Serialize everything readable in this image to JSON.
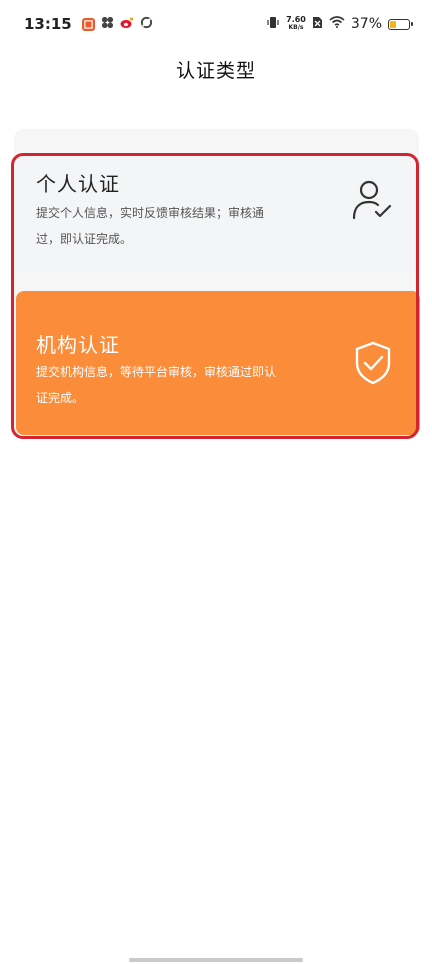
{
  "status_bar": {
    "time": "13:15",
    "net_speed_value": "7.60",
    "net_speed_unit": "KB/s",
    "battery_percent": "37%",
    "battery_level": 0.37,
    "battery_color": "#f3b51b"
  },
  "header": {
    "title": "认证类型"
  },
  "cards": [
    {
      "title": "个人认证",
      "description": "提交个人信息，实时反馈审核结果；审核通过，即认证完成。",
      "icon": "user-check-icon"
    },
    {
      "title": "机构认证",
      "description": "提交机构信息，等待平台审核，审核通过即认证完成。",
      "icon": "shield-check-icon",
      "accent_color": "#fa8c3a"
    }
  ],
  "highlight_color": "#d42331"
}
